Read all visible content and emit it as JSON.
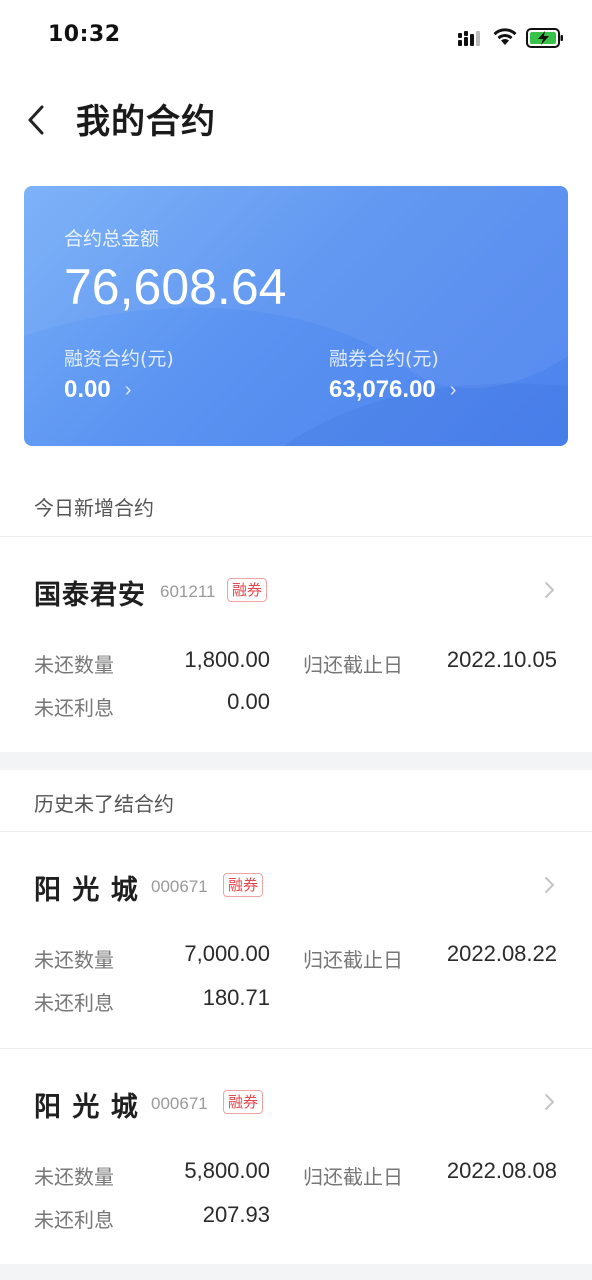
{
  "status_bar": {
    "time": "10:32",
    "signal_icon": "cellular-signal-icon",
    "wifi_icon": "wifi-icon",
    "battery_icon": "battery-charging-icon"
  },
  "nav": {
    "back_icon": "chevron-left-icon",
    "title": "我的合约"
  },
  "summary": {
    "total_label": "合约总金额",
    "total_amount": "76,608.64",
    "financing_label": "融资合约(元)",
    "financing_value": "0.00",
    "securities_label": "融券合约(元)",
    "securities_value": "63,076.00",
    "chevron": "›",
    "gradient_colors": [
      "#76aef8",
      "#4c82ee"
    ]
  },
  "sections": {
    "today_title": "今日新增合约",
    "history_title": "历史未了结合约"
  },
  "contracts": [
    {
      "name": "国泰君安",
      "code": "601211",
      "tag": "融券",
      "qty_label": "未还数量",
      "qty_value": "1,800.00",
      "interest_label": "未还利息",
      "interest_value": "0.00",
      "due_label": "归还截止日",
      "due_value": "2022.10.05"
    },
    {
      "name": "阳 光 城",
      "code": "000671",
      "tag": "融券",
      "qty_label": "未还数量",
      "qty_value": "7,000.00",
      "interest_label": "未还利息",
      "interest_value": "180.71",
      "due_label": "归还截止日",
      "due_value": "2022.08.22"
    },
    {
      "name": "阳 光 城",
      "code": "000671",
      "tag": "融券",
      "qty_label": "未还数量",
      "qty_value": "5,800.00",
      "interest_label": "未还利息",
      "interest_value": "207.93",
      "due_label": "归还截止日",
      "due_value": "2022.08.08"
    }
  ],
  "colors": {
    "tag_red": "#e5484d",
    "card_blue": "#5a93f1",
    "gap_gray": "#f3f4f6"
  }
}
